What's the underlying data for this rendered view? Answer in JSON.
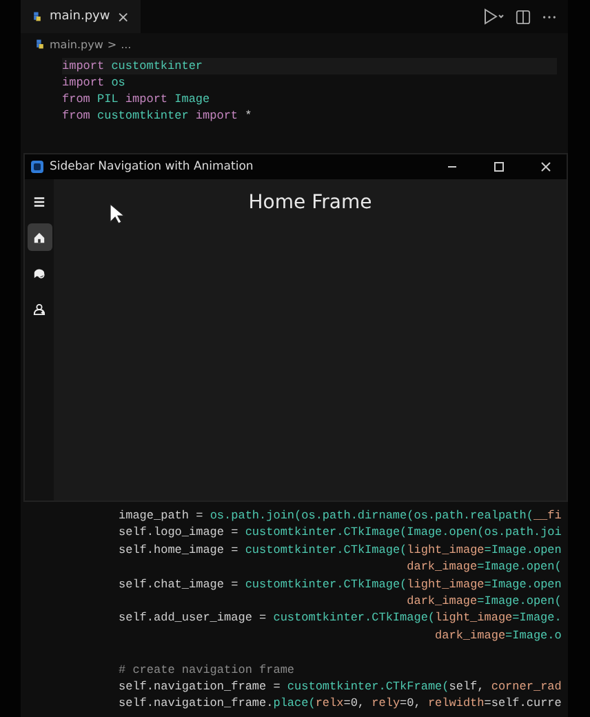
{
  "editor_tab": {
    "label": "main.pyw",
    "close": "×",
    "selected": true
  },
  "breadcrumb": {
    "file": "main.pyw",
    "separator": ">",
    "rest": "..."
  },
  "code_top": [
    [
      {
        "text": "import",
        "kind": "keyword"
      },
      {
        "text": " customtkinter",
        "kind": "module"
      }
    ],
    [
      {
        "text": "import",
        "kind": "keyword"
      },
      {
        "text": " os",
        "kind": "module"
      }
    ],
    [
      {
        "text": "from",
        "kind": "keyword"
      },
      {
        "text": " PIL ",
        "kind": "module"
      },
      {
        "text": "import",
        "kind": "keyword"
      },
      {
        "text": " Image",
        "kind": "module"
      }
    ],
    [
      {
        "text": "from",
        "kind": "keyword"
      },
      {
        "text": " customtkinter ",
        "kind": "module"
      },
      {
        "text": "import",
        "kind": "keyword"
      },
      {
        "text": " *",
        "kind": "plain"
      }
    ]
  ],
  "app_window": {
    "title": "Sidebar Navigation with Animation",
    "heading": "Home Frame",
    "nav": [
      {
        "kind": "menu",
        "selected": false
      },
      {
        "kind": "home",
        "selected": true
      },
      {
        "kind": "chat",
        "selected": false
      },
      {
        "kind": "add_user",
        "selected": false
      }
    ]
  },
  "code_bottom": [
    {
      "kind": "statement",
      "parts": [
        {
          "text": "image_path = ",
          "kind": "plain"
        },
        {
          "text": "os.path.join(os.path.dirname(os.path.realpath(",
          "kind": "module"
        },
        {
          "text": "__fi",
          "kind": "param"
        }
      ]
    },
    {
      "kind": "statement",
      "parts": [
        {
          "text": "self.logo_image = ",
          "kind": "plain"
        },
        {
          "text": "customtkinter.CTkImage(Image.open(os.path.joi",
          "kind": "module"
        }
      ]
    },
    {
      "kind": "statement",
      "parts": [
        {
          "text": "self.home_image = ",
          "kind": "plain"
        },
        {
          "text": "customtkinter.CTkImage(",
          "kind": "module"
        },
        {
          "text": "light_image",
          "kind": "param"
        },
        {
          "text": "=Image.open",
          "kind": "module"
        }
      ]
    },
    {
      "kind": "continuation",
      "parts": [
        {
          "text": "dark_image",
          "kind": "param"
        },
        {
          "text": "=Image.open(",
          "kind": "module"
        }
      ]
    },
    {
      "kind": "statement",
      "parts": [
        {
          "text": "self.chat_image = ",
          "kind": "plain"
        },
        {
          "text": "customtkinter.CTkImage(",
          "kind": "module"
        },
        {
          "text": "light_image",
          "kind": "param"
        },
        {
          "text": "=Image.open",
          "kind": "module"
        }
      ]
    },
    {
      "kind": "continuation",
      "parts": [
        {
          "text": "dark_image",
          "kind": "param"
        },
        {
          "text": "=Image.open(",
          "kind": "module"
        }
      ]
    },
    {
      "kind": "statement",
      "parts": [
        {
          "text": "self.add_user_image = ",
          "kind": "plain"
        },
        {
          "text": "customtkinter.CTkImage(",
          "kind": "module"
        },
        {
          "text": "light_image",
          "kind": "param"
        },
        {
          "text": "=Image.",
          "kind": "module"
        }
      ]
    },
    {
      "kind": "continuation",
      "parts": [
        {
          "text": "dark_image",
          "kind": "param"
        },
        {
          "text": "=Image.o",
          "kind": "module"
        }
      ]
    },
    {
      "kind": "comment",
      "parts": [
        {
          "text": "# create navigation frame",
          "kind": "comment"
        }
      ]
    },
    {
      "kind": "statement",
      "parts": [
        {
          "text": "self.navigation_frame = ",
          "kind": "plain"
        },
        {
          "text": "customtkinter.CTkFrame(",
          "kind": "module"
        },
        {
          "text": "self, ",
          "kind": "plain"
        },
        {
          "text": "corner_rad",
          "kind": "param"
        }
      ]
    },
    {
      "kind": "statement",
      "parts": [
        {
          "text": "self.navigation_frame.",
          "kind": "plain"
        },
        {
          "text": "place(",
          "kind": "module"
        },
        {
          "text": "relx",
          "kind": "param"
        },
        {
          "text": "=0, ",
          "kind": "plain"
        },
        {
          "text": "rely",
          "kind": "param"
        },
        {
          "text": "=0, ",
          "kind": "plain"
        },
        {
          "text": "relwidth",
          "kind": "param"
        },
        {
          "text": "=self.curre",
          "kind": "plain"
        }
      ]
    }
  ]
}
